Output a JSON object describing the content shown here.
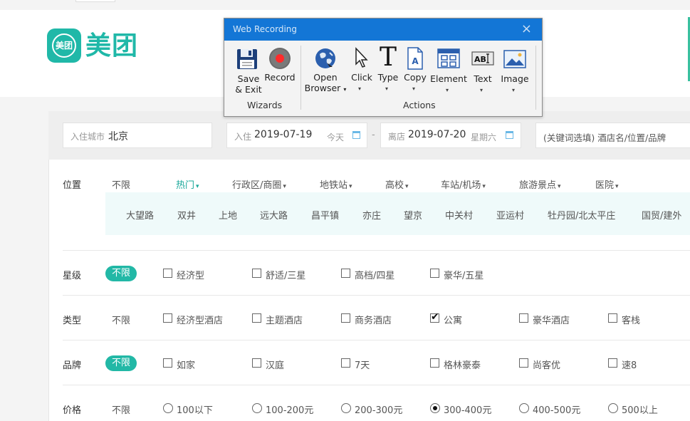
{
  "brand": {
    "logo_badge": "美团",
    "logo_text": "美团",
    "accent": "#22b8a6"
  },
  "search": {
    "city_label": "入住城市",
    "city_value": "北京",
    "checkin_label": "入住",
    "checkin_value": "2019-07-19",
    "checkin_sub": "今天",
    "separator": "-",
    "checkout_label": "离店",
    "checkout_value": "2019-07-20",
    "checkout_sub": "星期六",
    "keyword_placeholder": "(关键词选填) 酒店名/位置/品牌"
  },
  "filters": {
    "location": {
      "label": "位置",
      "options": [
        "不限",
        "热门",
        "行政区/商圈",
        "地铁站",
        "高校",
        "车站/机场",
        "旅游景点",
        "医院"
      ],
      "active": "热门",
      "hot": [
        "大望路",
        "双井",
        "上地",
        "远大路",
        "昌平镇",
        "亦庄",
        "望京",
        "中关村",
        "亚运村",
        "牡丹园/北太平庄",
        "国贸/建外"
      ]
    },
    "star": {
      "label": "星级",
      "all": "不限",
      "options": [
        "经济型",
        "舒适/三星",
        "高档/四星",
        "豪华/五星"
      ]
    },
    "type": {
      "label": "类型",
      "all": "不限",
      "options": [
        "经济型酒店",
        "主题酒店",
        "商务酒店",
        "公寓",
        "豪华酒店",
        "客栈"
      ],
      "checked": "公寓"
    },
    "brand": {
      "label": "品牌",
      "all": "不限",
      "options": [
        "如家",
        "汉庭",
        "7天",
        "格林豪泰",
        "尚客优",
        "速8"
      ]
    },
    "price": {
      "label": "价格",
      "all": "不限",
      "options": [
        "100以下",
        "100-200元",
        "200-300元",
        "300-400元",
        "400-500元",
        "500以上"
      ],
      "checked": "300-400元"
    }
  },
  "recorder": {
    "title": "Web Recording",
    "close": "×",
    "save_line1": "Save",
    "save_line2": "& Exit",
    "record": "Record",
    "open_line1": "Open",
    "open_line2": "Browser",
    "click": "Click",
    "type": "Type",
    "copy": "Copy",
    "element": "Element",
    "text": "Text",
    "image": "Image",
    "group_wizards": "Wizards",
    "group_actions": "Actions"
  }
}
